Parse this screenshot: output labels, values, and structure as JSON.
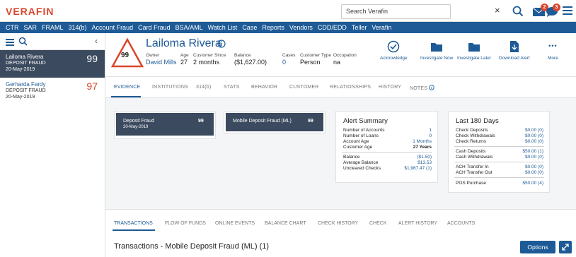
{
  "topbar": {
    "logo": "VERAFIN",
    "search_value": "Search Verafin",
    "search_clear": "×",
    "notif_mail_count": "2",
    "notif_chat_count": "3",
    "colors": {
      "accent": "#1d5a96",
      "brand": "#d9462c"
    }
  },
  "nav": {
    "items": [
      "CTR",
      "SAR",
      "FRAML",
      "314(b)",
      "Account Fraud",
      "Card Fraud",
      "BSA/AML",
      "Watch List",
      "Case",
      "Reports",
      "Vendors",
      "CDD/EDD",
      "Teller",
      "Verafin"
    ]
  },
  "sidebar": {
    "collapse_chevron": "‹",
    "items": [
      {
        "name": "Lailoma Rivera",
        "type": "DEPOSIT FRAUD",
        "date": "20-May-2019",
        "score": "99"
      },
      {
        "name": "Gerharda Fardy",
        "type": "DEPOSIT FRAUD",
        "date": "20-May-2019",
        "score": "97"
      }
    ]
  },
  "header": {
    "risk_score": "99",
    "name": "Lailoma Rivera",
    "fields": {
      "owner_label": "Owner",
      "owner": "David Mills",
      "age_label": "Age",
      "age": "27",
      "since_label": "Customer Since",
      "since": "2 months",
      "balance_label": "Balance",
      "balance": "($1,627.00)",
      "cases_label": "Cases",
      "cases": "0",
      "type_label": "Customer Type",
      "type": "Person",
      "occupation_label": "Occupation",
      "occupation": "na"
    },
    "actions": {
      "acknowledge": "Acknowledge",
      "investigate_now": "Investigate Now",
      "investigate_later": "Investigate Later",
      "download_alert": "Download Alert",
      "more": "More",
      "more_glyph": "•••"
    }
  },
  "evidence_tabs": [
    "EVIDENCE",
    "INSTITUTIONS",
    "314(b)",
    "STATS",
    "BEHAVIOR",
    "CUSTOMER",
    "RELATIONSHIPS",
    "HISTORY",
    "NOTES"
  ],
  "evidence": {
    "deposit_card": {
      "title": "Deposit Fraud",
      "date": "20-May-2019",
      "score": "99"
    },
    "mobile_card": {
      "title": "Mobile Deposit Fraud (ML)",
      "score": "99"
    }
  },
  "alert_summary": {
    "title": "Alert Summary",
    "rows": [
      {
        "label": "Number of Accounts",
        "value": "1"
      },
      {
        "label": "Number of Loans",
        "value": "0"
      },
      {
        "label": "Account Age",
        "value": "1 Months"
      },
      {
        "label": "Customer Age",
        "value": "27 Years"
      },
      {
        "label": "Balance",
        "value": "($1.50)"
      },
      {
        "label": "Average Balance",
        "value": "$13.53"
      },
      {
        "label": "Uncleared Checks",
        "value": "$1,967.47 (1)"
      }
    ]
  },
  "last180": {
    "title": "Last 180 Days",
    "rows": [
      {
        "label": "Check Deposits",
        "value": "$0.00 (0)"
      },
      {
        "label": "Check Withdrawals",
        "value": "$0.00 (0)"
      },
      {
        "label": "Check Returns",
        "value": "$0.00 (0)"
      },
      {
        "label": "Cash Deposits",
        "value": "$50.00 (1)"
      },
      {
        "label": "Cash Withdrawals",
        "value": "$0.00 (0)"
      },
      {
        "label": "ACH Transfer In",
        "value": "$0.00 (0)"
      },
      {
        "label": "ACH Transfer Out",
        "value": "$0.00 (0)"
      },
      {
        "label": "POS Purchase",
        "value": "$50.00 (4)"
      }
    ]
  },
  "bottom_tabs": [
    "TRANSACTIONS",
    "FLOW OF FUNDS",
    "ONLINE EVENTS",
    "BALANCE CHART",
    "CHECK HISTORY",
    "CHECK",
    "ALERT HISTORY",
    "ACCOUNTS"
  ],
  "transactions": {
    "title": "Transactions - Mobile Deposit Fraud (ML) (1)",
    "options_label": "Options"
  }
}
